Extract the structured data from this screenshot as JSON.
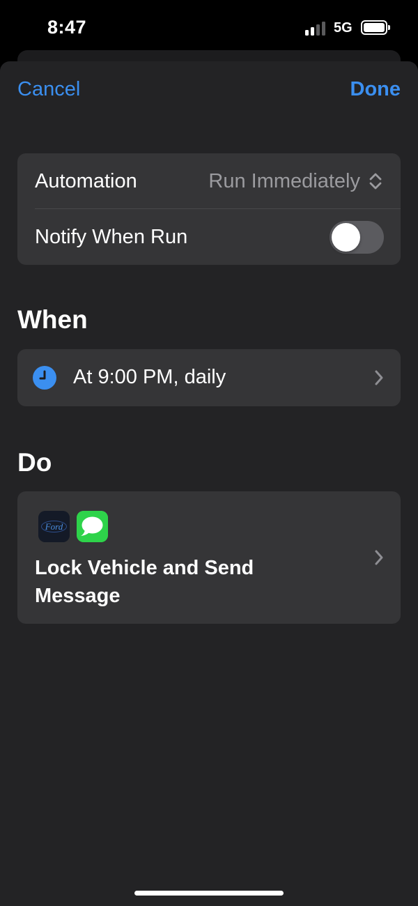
{
  "status_bar": {
    "time": "8:47",
    "network": "5G",
    "signal_icon": "cellular-signal-icon",
    "battery_icon": "battery-icon"
  },
  "nav": {
    "cancel_label": "Cancel",
    "done_label": "Done"
  },
  "settings": {
    "automation_label": "Automation",
    "automation_value": "Run Immediately",
    "automation_icon": "chevron-up-down-icon",
    "notify_label": "Notify When Run",
    "notify_enabled": false
  },
  "when": {
    "title": "When",
    "trigger_text": "At 9:00 PM, daily",
    "trigger_icon": "clock-icon"
  },
  "do": {
    "title": "Do",
    "action_text": "Lock Vehicle and Send Message",
    "app_icons": [
      "ford-app-icon",
      "messages-app-icon"
    ],
    "ford_logo_text": "Ford"
  },
  "colors": {
    "accent": "#3b8ff0",
    "sheet_background": "#232325",
    "card_background": "#353537",
    "secondary_text": "#9b9b9f",
    "toggle_off": "#5b5b5f",
    "messages_green": "#2ed34a"
  }
}
